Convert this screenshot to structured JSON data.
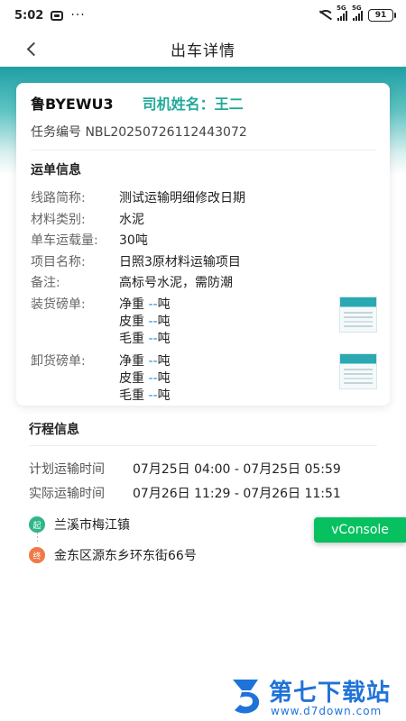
{
  "status_bar": {
    "time": "5:02",
    "dots": "···",
    "network_1": "5G",
    "network_2": "5G",
    "battery": "91"
  },
  "nav": {
    "title": "出车详情"
  },
  "card": {
    "plate": "鲁BYEWU3",
    "driver_label": "司机姓名：王二",
    "task_label": "任务编号",
    "task_no": "NBL20250726112443072",
    "section_title": "运单信息",
    "rows": [
      {
        "label": "线路简称:",
        "value": "测试运输明细修改日期"
      },
      {
        "label": "材料类别:",
        "value": "水泥"
      },
      {
        "label": "单车运载量:",
        "value": "30吨"
      },
      {
        "label": "项目名称:",
        "value": "日照3原材料运输项目"
      },
      {
        "label": "备注:",
        "value": "高标号水泥，需防潮"
      }
    ],
    "load": {
      "label": "装货磅单:",
      "items": [
        {
          "name": "净重",
          "value": "--",
          "unit": "吨"
        },
        {
          "name": "皮重",
          "value": "--",
          "unit": "吨"
        },
        {
          "name": "毛重",
          "value": "--",
          "unit": "吨"
        }
      ]
    },
    "unload": {
      "label": "卸货磅单:",
      "items": [
        {
          "name": "净重",
          "value": "--",
          "unit": "吨"
        },
        {
          "name": "皮重",
          "value": "--",
          "unit": "吨"
        },
        {
          "name": "毛重",
          "value": "--",
          "unit": "吨"
        }
      ]
    }
  },
  "trip": {
    "title": "行程信息",
    "planned_label": "计划运输时间",
    "planned_value": "07月25日 04:00 - 07月25日 05:59",
    "actual_label": "实际运输时间",
    "actual_value": "07月26日 11:29 - 07月26日 11:51",
    "start_badge": "起",
    "start": "兰溪市梅江镇",
    "end_badge": "终",
    "end": "金东区源东乡环东街66号"
  },
  "vconsole": {
    "label": "vConsole"
  },
  "watermark": {
    "brand": "第七下载站",
    "url": "www.d7down.com"
  },
  "colors": {
    "accent": "#21a99b",
    "header_gradient_top": "#1e9fa4",
    "vconsole": "#07c160",
    "start_dot": "#2fb68a",
    "end_dot": "#ef7a45",
    "dash_value": "#1f8ed8",
    "watermark": "#1f73d8"
  }
}
